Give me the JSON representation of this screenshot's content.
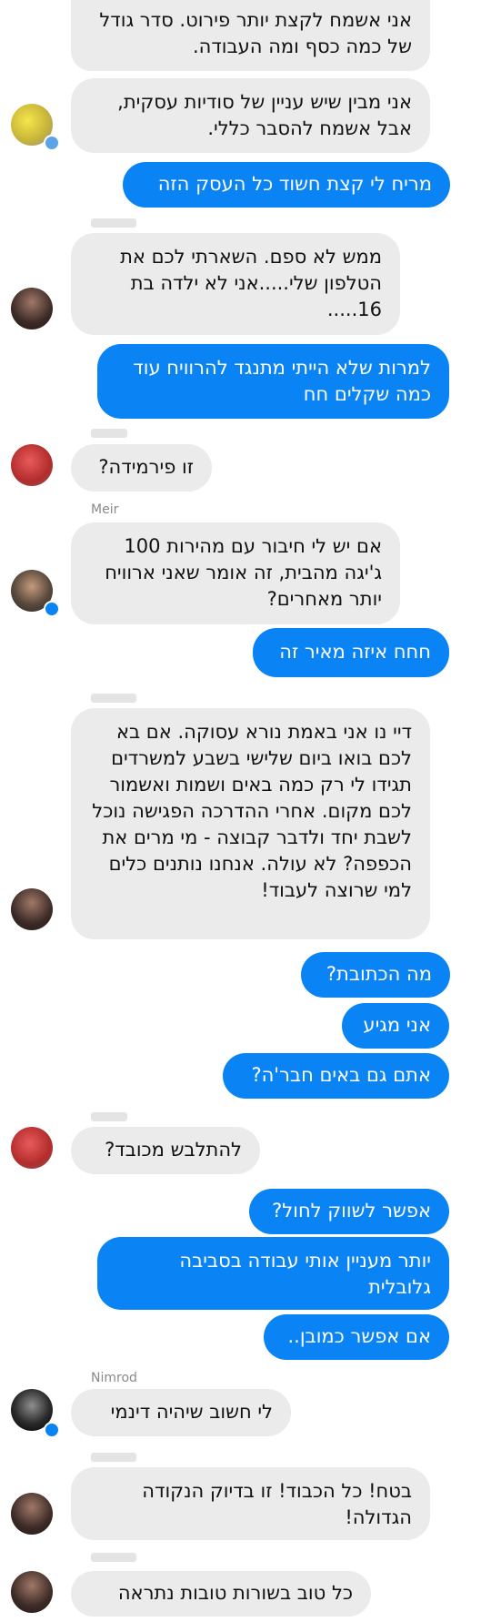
{
  "messages": [
    {
      "text": "אני אשמח לקצת יותר פירוט. סדר גודל של כמה כסף ומה העבודה."
    },
    {
      "text": "אני מבין שיש עניין של סודיות עסקית, אבל אשמח להסבר כללי."
    },
    {
      "text": "מריח לי קצת חשוד כל העסק הזה"
    },
    {
      "text": "ממש לא ספם. השארתי לכם את הטלפון שלי.....אני לא ילדה בת 16....."
    },
    {
      "text": "למרות שלא הייתי מתנגד להרוויח עוד כמה שקלים חח"
    },
    {
      "text": "זו פירמידה?"
    },
    {
      "text": "אם יש לי חיבור עם מהירות 100 ג'יגה מהבית, זה אומר שאני ארוויח יותר מאחרים?"
    },
    {
      "text": "חחח איזה מאיר זה"
    },
    {
      "text": "דיי נו אני באמת נורא עסוקה. אם בא לכם בואו ביום שלישי בשבע למשרדים תגידו לי רק כמה באים ושמות ואשמור לכם מקום. אחרי ההדרכה הפגישה נוכל לשבת יחד ולדבר קבוצה - מי מרים את הכפפה? לא עולה. אנחנו נותנים כלים למי שרוצה לעבוד!"
    },
    {
      "text": "מה הכתובת?"
    },
    {
      "text": "אני מגיע"
    },
    {
      "text": "אתם גם באים חבר'ה?"
    },
    {
      "text": "להתלבש מכובד?"
    },
    {
      "text": "אפשר לשווק לחול?"
    },
    {
      "text": "יותר מעניין אותי עבודה בסביבה גלובלית"
    },
    {
      "text": "אם אפשר כמובן.."
    },
    {
      "text": "לי חשוב שיהיה דינמי"
    },
    {
      "text": "בטח! כל הכבוד! זו בדיוק הנקודה הגדולה!"
    },
    {
      "text": "כל טוב בשורות טובות נתראה"
    }
  ],
  "senders": {
    "meir": "Meir",
    "nimrod": "Nimrod"
  },
  "colors": {
    "outgoing_bubble": "#0a84f4",
    "incoming_bubble": "#ebebeb",
    "sender_name": "#8a8a8a"
  },
  "icons": {
    "messenger_badge": "messenger-badge-icon"
  }
}
